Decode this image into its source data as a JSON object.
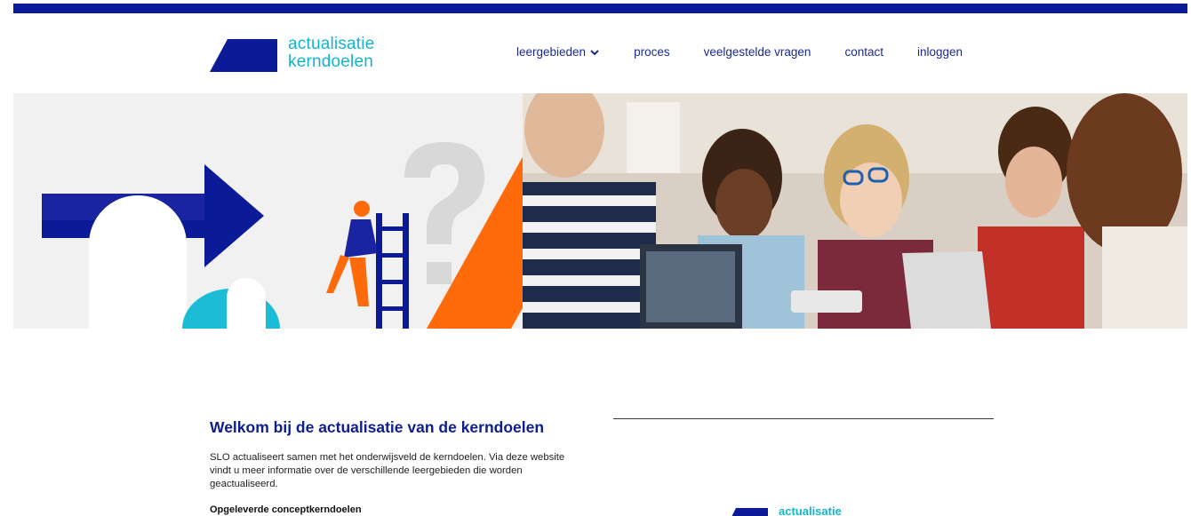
{
  "brand": {
    "line1": "actualisatie",
    "line2": "kerndoelen",
    "colors": {
      "navy": "#0b1a96",
      "cyan": "#14b4cc",
      "orange": "#ff6b0a"
    }
  },
  "nav": {
    "items": [
      {
        "label": "leergebieden",
        "has_dropdown": true
      },
      {
        "label": "proces"
      },
      {
        "label": "veelgestelde vragen"
      },
      {
        "label": "contact"
      },
      {
        "label": "inloggen"
      }
    ]
  },
  "hero": {
    "alt": "illustration-and-students-photo"
  },
  "main": {
    "title": "Welkom bij de actualisatie van de kerndoelen",
    "paragraph": "SLO actualiseert samen met het onderwijsveld de kerndoelen. Via deze website vindt u meer informatie over de verschillende leergebieden die worden geactualiseerd.",
    "subheading": "Opgeleverde conceptkerndoelen"
  },
  "video_logo": {
    "text": "actualisatie"
  }
}
